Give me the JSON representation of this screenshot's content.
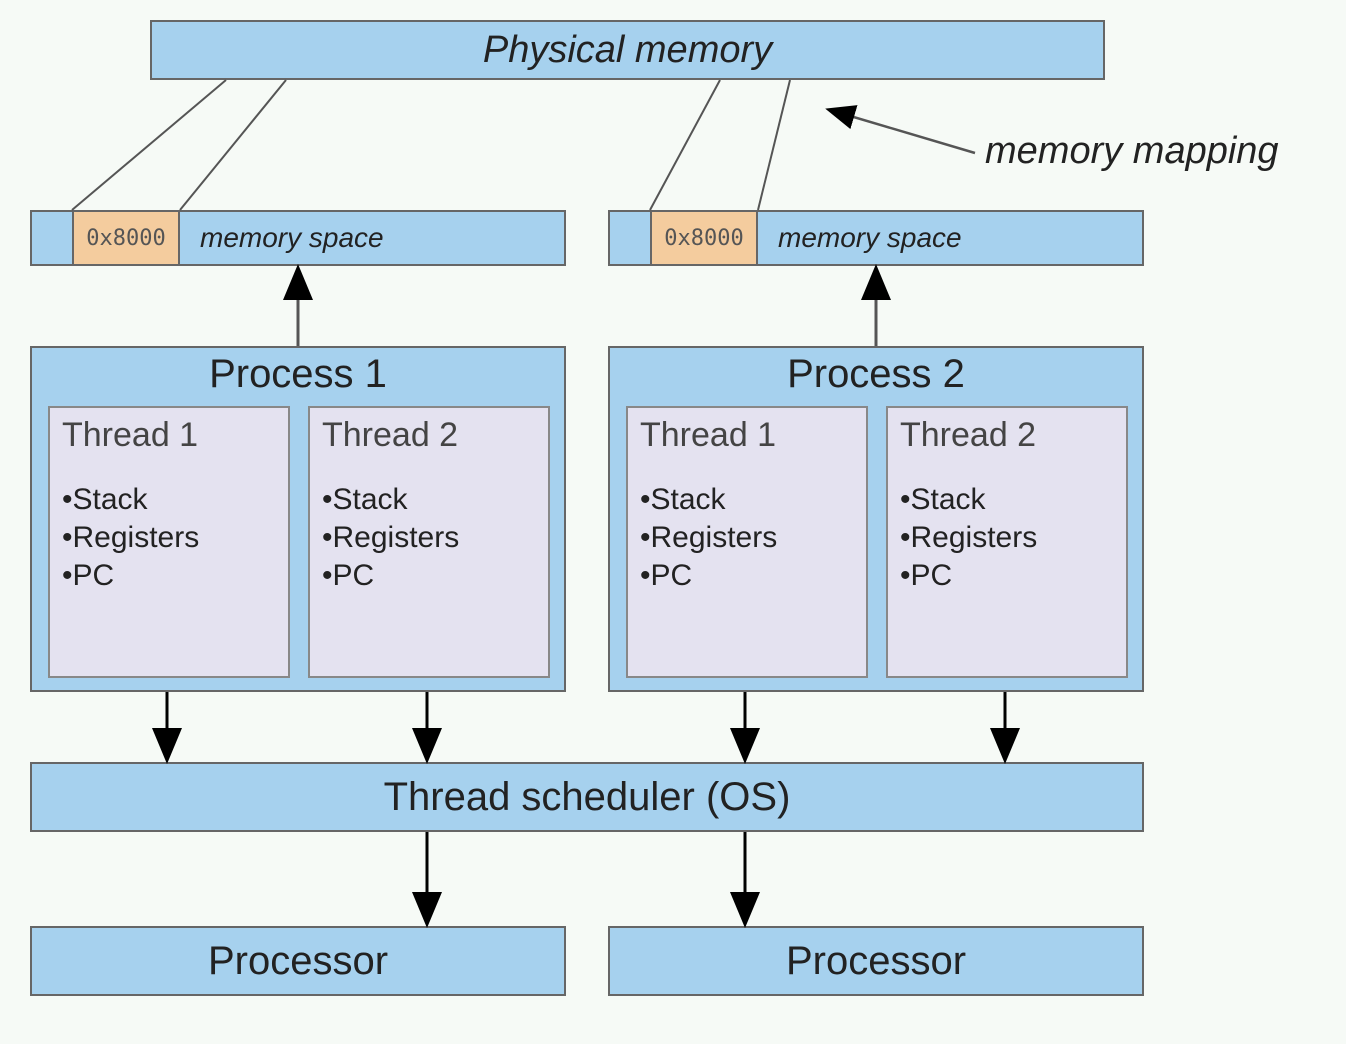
{
  "physical_memory_label": "Physical memory",
  "memory_mapping_label": "memory mapping",
  "memory_space_label_1": "memory space",
  "memory_space_label_2": "memory space",
  "addr_1": "0x8000",
  "addr_2": "0x8000",
  "process_1": {
    "title": "Process 1",
    "threads": [
      {
        "title": "Thread 1",
        "items": [
          "Stack",
          "Registers",
          "PC"
        ]
      },
      {
        "title": "Thread 2",
        "items": [
          "Stack",
          "Registers",
          "PC"
        ]
      }
    ]
  },
  "process_2": {
    "title": "Process 2",
    "threads": [
      {
        "title": "Thread 1",
        "items": [
          "Stack",
          "Registers",
          "PC"
        ]
      },
      {
        "title": "Thread 2",
        "items": [
          "Stack",
          "Registers",
          "PC"
        ]
      }
    ]
  },
  "scheduler_label": "Thread scheduler (OS)",
  "processor_label_1": "Processor",
  "processor_label_2": "Processor",
  "colors": {
    "box_fill": "#a6d1ee",
    "thread_fill": "#e4e2f0",
    "addr_fill": "#f4cc9e",
    "background": "#f6faf6"
  }
}
